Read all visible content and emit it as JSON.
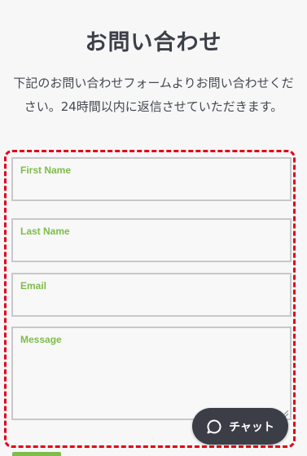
{
  "page": {
    "title": "お問い合わせ",
    "description": "下記のお問い合わせフォームよりお問い合わせください。24時間以内に返信させていただきます。"
  },
  "form": {
    "first_name_label": "First Name",
    "last_name_label": "Last Name",
    "email_label": "Email",
    "message_label": "Message",
    "first_name_value": "",
    "last_name_value": "",
    "email_value": "",
    "message_value": ""
  },
  "chat": {
    "label": "チャット",
    "icon": "chat-bubble-icon"
  },
  "colors": {
    "label_green": "#7dbd4a",
    "frame_red": "#e0001a",
    "chat_bg": "#3b3e46"
  }
}
